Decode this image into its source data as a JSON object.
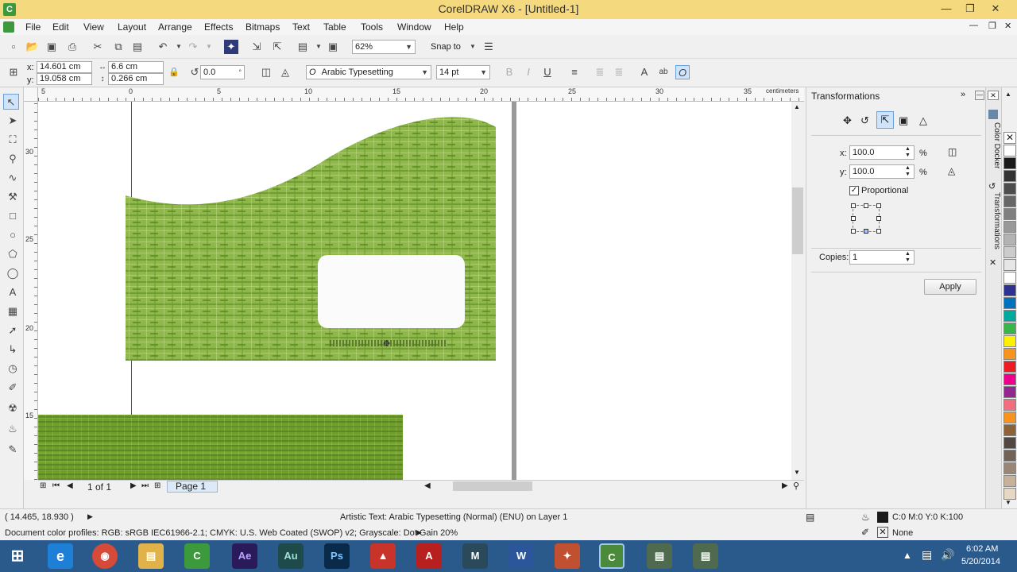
{
  "window": {
    "title": "CorelDRAW X6 - [Untitled-1]"
  },
  "menu": [
    "File",
    "Edit",
    "View",
    "Layout",
    "Arrange",
    "Effects",
    "Bitmaps",
    "Text",
    "Table",
    "Tools",
    "Window",
    "Help"
  ],
  "toolbar": {
    "zoom": "62%",
    "snap_to": "Snap to"
  },
  "properties": {
    "x": "14.601 cm",
    "y": "19.058 cm",
    "w": "6.6 cm",
    "h": "0.266 cm",
    "rotation": "0.0",
    "font": "Arabic Typesetting",
    "font_size": "14 pt",
    "degree": "°"
  },
  "ruler": {
    "h_ticks": [
      "5",
      "0",
      "5",
      "10",
      "15",
      "20",
      "25",
      "30",
      "35"
    ],
    "v_ticks": [
      "30",
      "25",
      "20",
      "15"
    ],
    "unit": "centimeters"
  },
  "page_nav": {
    "count": "1 of 1",
    "tab": "Page 1"
  },
  "docker": {
    "title": "Transformations",
    "x_label": "x:",
    "x_value": "100.0",
    "y_label": "y:",
    "y_value": "100.0",
    "percent": "%",
    "proportional": "Proportional",
    "copies_label": "Copies:",
    "copies_value": "1",
    "apply": "Apply"
  },
  "dock_tabs": [
    "Color Docker",
    "Transformations"
  ],
  "palette": [
    "#ffffff",
    "#1a1a1a",
    "#333333",
    "#4d4d4d",
    "#666666",
    "#808080",
    "#999999",
    "#b3b3b3",
    "#cccccc",
    "#e6e6e6",
    "#ffffff",
    "#2e3192",
    "#0071bc",
    "#00a99d",
    "#39b54a",
    "#fff200",
    "#f7941d",
    "#ed1c24",
    "#ec008c",
    "#92278f",
    "#f26d7d",
    "#f7931e",
    "#8c6239",
    "#534741",
    "#736357",
    "#998675",
    "#c7b299",
    "#e6d8c3",
    "#d9d9d9"
  ],
  "status": {
    "coords": "( 14.465, 18.930 )",
    "object_info": "Artistic Text: Arabic Typesetting (Normal) (ENU) on Layer 1",
    "profiles": "Document color profiles: RGB: sRGB IEC61966-2.1; CMYK: U.S. Web Coated (SWOP) v2; Grayscale: Dot Gain 20%",
    "fill": "C:0 M:0 Y:0 K:100",
    "outline": "None"
  },
  "taskbar": {
    "apps": [
      "Ae",
      "Au",
      "Ps"
    ],
    "time": "6:02 AM",
    "date": "5/20/2014"
  },
  "colors": {
    "titlebar": "#f5d97e",
    "accent": "#3399ff",
    "taskbar": "#2a5a8c"
  }
}
